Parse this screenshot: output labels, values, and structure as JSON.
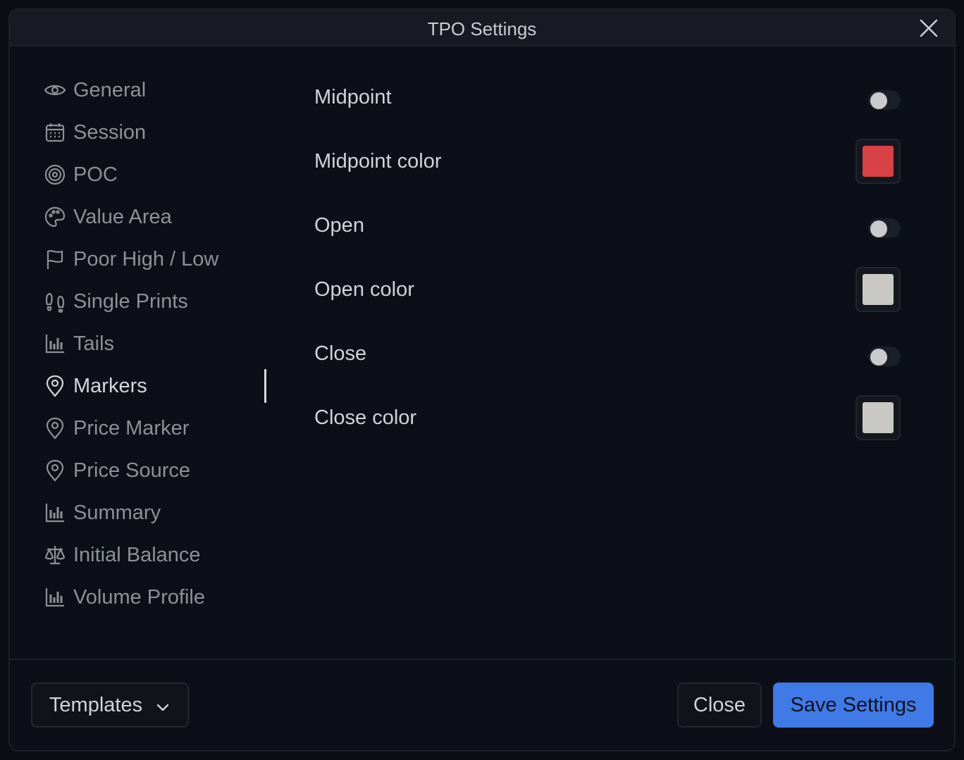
{
  "dialog": {
    "title": "TPO Settings"
  },
  "sidebar": {
    "items": [
      {
        "label": "General",
        "icon": "eye-icon"
      },
      {
        "label": "Session",
        "icon": "calendar-icon"
      },
      {
        "label": "POC",
        "icon": "target-icon"
      },
      {
        "label": "Value Area",
        "icon": "palette-icon"
      },
      {
        "label": "Poor High / Low",
        "icon": "flag-icon"
      },
      {
        "label": "Single Prints",
        "icon": "footprints-icon"
      },
      {
        "label": "Tails",
        "icon": "bar-chart-icon"
      },
      {
        "label": "Markers",
        "icon": "map-pin-icon"
      },
      {
        "label": "Price Marker",
        "icon": "map-pin-icon"
      },
      {
        "label": "Price Source",
        "icon": "map-pin-icon"
      },
      {
        "label": "Summary",
        "icon": "bar-chart-icon"
      },
      {
        "label": "Initial Balance",
        "icon": "scale-icon"
      },
      {
        "label": "Volume Profile",
        "icon": "bar-chart-icon"
      }
    ],
    "active": "Markers"
  },
  "settings": {
    "midpoint_label": "Midpoint",
    "midpoint_on": false,
    "midpoint_color_label": "Midpoint color",
    "midpoint_color": "#d84145",
    "open_label": "Open",
    "open_on": false,
    "open_color_label": "Open color",
    "open_color": "#c9c8c4",
    "close_label": "Close",
    "close_on": false,
    "close_color_label": "Close color",
    "close_color": "#c9c8c4"
  },
  "footer": {
    "templates_label": "Templates",
    "close_label": "Close",
    "save_label": "Save Settings"
  },
  "colors": {
    "accent": "#3f7ae6"
  }
}
